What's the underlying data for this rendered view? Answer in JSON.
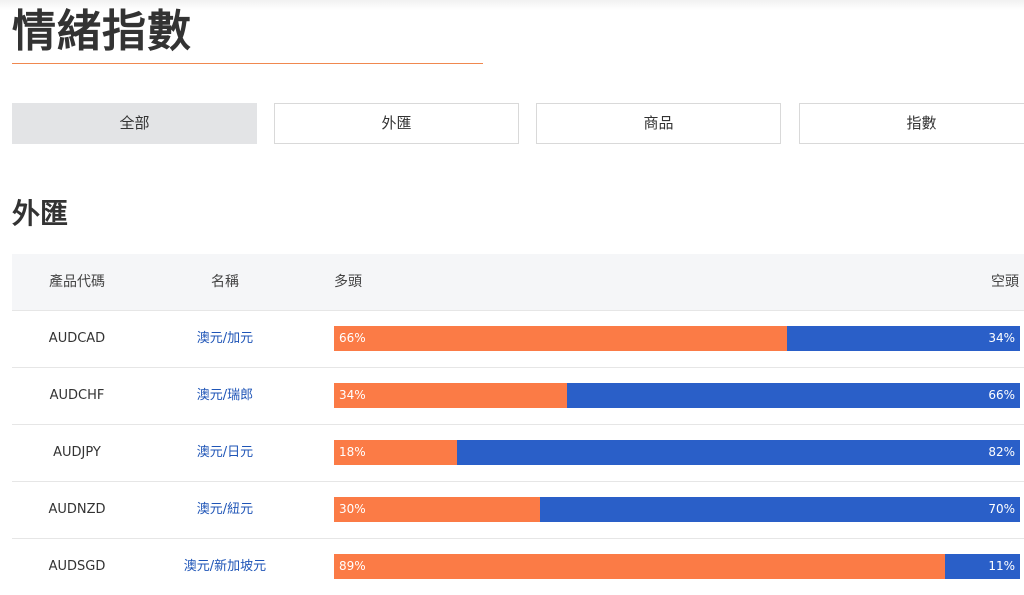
{
  "page": {
    "title": "情緒指數"
  },
  "tabs": [
    {
      "label": "全部",
      "active": true
    },
    {
      "label": "外匯",
      "active": false
    },
    {
      "label": "商品",
      "active": false
    },
    {
      "label": "指數",
      "active": false
    }
  ],
  "section": {
    "title": "外匯",
    "columns": {
      "code": "產品代碼",
      "name": "名稱",
      "long": "多頭",
      "short": "空頭"
    },
    "rows": [
      {
        "code": "AUDCAD",
        "name": "澳元/加元",
        "long": 66,
        "short": 34,
        "long_label": "66%",
        "short_label": "34%"
      },
      {
        "code": "AUDCHF",
        "name": "澳元/瑞郎",
        "long": 34,
        "short": 66,
        "long_label": "34%",
        "short_label": "66%"
      },
      {
        "code": "AUDJPY",
        "name": "澳元/日元",
        "long": 18,
        "short": 82,
        "long_label": "18%",
        "short_label": "82%"
      },
      {
        "code": "AUDNZD",
        "name": "澳元/紐元",
        "long": 30,
        "short": 70,
        "long_label": "30%",
        "short_label": "70%"
      },
      {
        "code": "AUDSGD",
        "name": "澳元/新加坡元",
        "long": 89,
        "short": 11,
        "long_label": "89%",
        "short_label": "11%"
      }
    ]
  },
  "colors": {
    "accent": "#f0884f",
    "long_bar": "#fb7b46",
    "short_bar": "#2a5fc8",
    "link": "#1f55b7"
  }
}
